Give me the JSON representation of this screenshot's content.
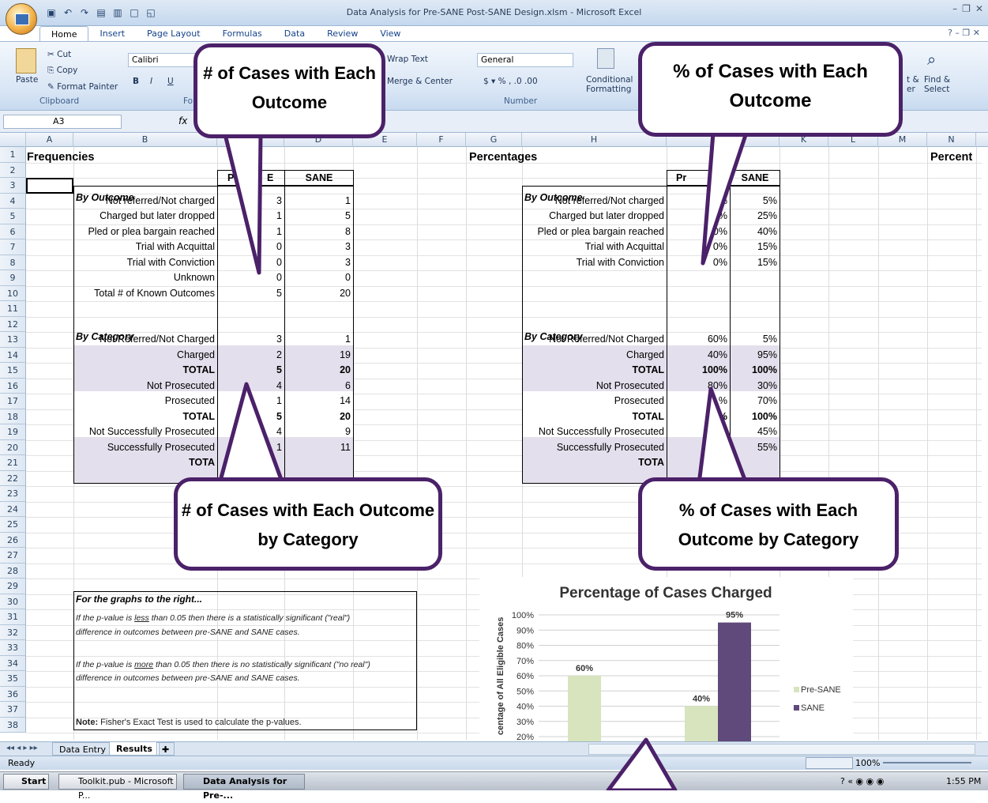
{
  "window": {
    "title": "Data Analysis for Pre-SANE Post-SANE Design.xlsm - Microsoft Excel"
  },
  "ribbon": {
    "tabs": [
      "Home",
      "Insert",
      "Page Layout",
      "Formulas",
      "Data",
      "Review",
      "View"
    ],
    "cut": "Cut",
    "copy": "Copy",
    "paste": "Paste",
    "format_painter": "Format Painter",
    "clipboard": "Clipboard",
    "font_name": "Calibri",
    "font_group": "Fo",
    "wrap_text": "Wrap Text",
    "merge_center": "Merge & Center",
    "number_format": "General",
    "number_group": "Number",
    "conditional": "Conditional",
    "formatting": "Formatting",
    "sort_partial": "t &",
    "filter_partial": "er",
    "find": "Find &",
    "select": "Select"
  },
  "formula_bar": {
    "name_box": "A3",
    "fx": "fx"
  },
  "columns": [
    "A",
    "B",
    "",
    "D",
    "E",
    "F",
    "G",
    "H",
    "",
    "",
    "K",
    "L",
    "M",
    "N"
  ],
  "rows": [
    "1",
    "2",
    "3",
    "4",
    "5",
    "6",
    "7",
    "8",
    "9",
    "10",
    "11",
    "12",
    "13",
    "14",
    "15",
    "16",
    "17",
    "18",
    "19",
    "20",
    "21",
    "22",
    "23",
    "24",
    "25",
    "26",
    "27",
    "28",
    "29",
    "30",
    "31",
    "32",
    "33",
    "34",
    "35",
    "36",
    "37",
    "38"
  ],
  "frequencies": {
    "title": "Frequencies",
    "hdr_pre": "P",
    "hdr_pre2": "E",
    "hdr_sane": "SANE",
    "by_outcome": "By Outcome",
    "outcome_rows": [
      {
        "label": "Not referred/Not charged",
        "pre": "3",
        "sane": "1"
      },
      {
        "label": "Charged but later dropped",
        "pre": "1",
        "sane": "5"
      },
      {
        "label": "Pled or plea bargain reached",
        "pre": "1",
        "sane": "8"
      },
      {
        "label": "Trial with Acquittal",
        "pre": "0",
        "sane": "3"
      },
      {
        "label": "Trial with Conviction",
        "pre": "0",
        "sane": "3"
      },
      {
        "label": "Unknown",
        "pre": "0",
        "sane": "0"
      },
      {
        "label": "Total # of Known Outcomes",
        "pre": "5",
        "sane": "20"
      }
    ],
    "by_category": "By Category",
    "category_rows": [
      {
        "label": "Not Referred/Not Charged",
        "pre": "3",
        "sane": "1"
      },
      {
        "label": "Charged",
        "pre": "2",
        "sane": "19"
      },
      {
        "label": "TOTAL",
        "pre": "5",
        "sane": "20"
      },
      {
        "label": "Not Prosecuted",
        "pre": "4",
        "sane": "6"
      },
      {
        "label": "Prosecuted",
        "pre": "1",
        "sane": "14"
      },
      {
        "label": "TOTAL",
        "pre": "5",
        "sane": "20"
      },
      {
        "label": "Not Successfully Prosecuted",
        "pre": "4",
        "sane": "9"
      },
      {
        "label": "Successfully Prosecuted",
        "pre": "1",
        "sane": "11"
      },
      {
        "label": "TOTA",
        "pre": "",
        "sane": ""
      }
    ]
  },
  "percentages": {
    "title": "Percentages",
    "hdr_pre": "Pr",
    "hdr_sane": "SANE",
    "by_outcome": "By Outcome",
    "outcome_rows": [
      {
        "label": "Not referred/Not charged",
        "pre": "%",
        "sane": "5%"
      },
      {
        "label": "Charged but later dropped",
        "pre": "20%",
        "sane": "25%"
      },
      {
        "label": "Pled or plea bargain reached",
        "pre": "20%",
        "sane": "40%"
      },
      {
        "label": "Trial with Acquittal",
        "pre": "0%",
        "sane": "15%"
      },
      {
        "label": "Trial with Conviction",
        "pre": "0%",
        "sane": "15%"
      }
    ],
    "by_category": "By Category",
    "category_rows": [
      {
        "label": "Not Referred/Not Charged",
        "pre": "60%",
        "sane": "5%"
      },
      {
        "label": "Charged",
        "pre": "40%",
        "sane": "95%"
      },
      {
        "label": "TOTAL",
        "pre": "100%",
        "sane": "100%"
      },
      {
        "label": "Not Prosecuted",
        "pre": "80%",
        "sane": "30%"
      },
      {
        "label": "Prosecuted",
        "pre": "%",
        "sane": "70%"
      },
      {
        "label": "TOTAL",
        "pre": "%",
        "sane": "100%"
      },
      {
        "label": "Not Successfully Prosecuted",
        "pre": "",
        "sane": "45%"
      },
      {
        "label": "Successfully Prosecuted",
        "pre": "",
        "sane": "55%"
      },
      {
        "label": "TOTA",
        "pre": "",
        "sane": ""
      }
    ],
    "n_header": "Percent"
  },
  "notes": {
    "heading": "For the graphs to the right...",
    "line1a": "If the p-value is",
    "line1_u": "less",
    "line1b": "than 0.05 then there is a statistically significant (\"real\")",
    "line2": "difference in outcomes between pre-SANE and SANE cases.",
    "line3a": "If the p-value is",
    "line3_u": "more",
    "line3b": "than 0.05 then there is no statistically significant (\"no real\")",
    "line4": "difference in outcomes between pre-SANE and SANE cases.",
    "fisher_bold": "Note:",
    "fisher": "Fisher's Exact Test is used to calculate the p-values."
  },
  "callouts": {
    "c1": "# of Cases with Each Outcome",
    "c2": "% of Cases with Each Outcome",
    "c3": "# of Cases with Each Outcome by Category",
    "c4": "% of Cases with Each Outcome by Category"
  },
  "chart_data": {
    "type": "bar",
    "title": "Percentage of Cases Charged",
    "ylabel": "centage of All Eligible Cases",
    "ylim": [
      0,
      100
    ],
    "yticks": [
      "100%",
      "90%",
      "80%",
      "70%",
      "60%",
      "50%",
      "40%",
      "30%",
      "20%"
    ],
    "categories": [
      "",
      ""
    ],
    "series": [
      {
        "name": "Pre-SANE",
        "values": [
          60,
          40
        ],
        "labels": [
          "60%",
          "40%"
        ],
        "color": "#d7e4bd"
      },
      {
        "name": "SANE",
        "values": [
          null,
          95
        ],
        "labels": [
          "",
          "95%"
        ],
        "color": "#604a7b"
      }
    ],
    "legend": "right"
  },
  "sheet_tabs": [
    "Data Entry",
    "Results"
  ],
  "status": {
    "ready": "Ready",
    "zoom": "100%"
  },
  "taskbar": {
    "start": "Start",
    "item1": "Toolkit.pub - Microsoft P...",
    "item2": "Data Analysis for Pre-...",
    "clock": "1:55 PM"
  },
  "colors": {
    "accent": "#4b2169",
    "shade": "#e4dfec"
  }
}
